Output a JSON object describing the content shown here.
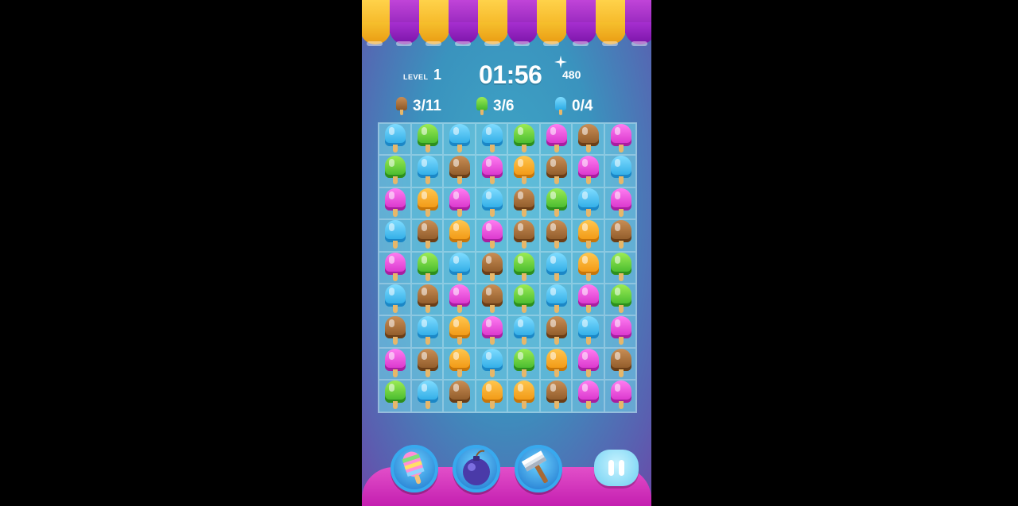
{
  "hud": {
    "level_label": "LEVEL",
    "level": "1",
    "timer": "01:56",
    "score": "480"
  },
  "goals": [
    {
      "color": "brown",
      "progress": "3/11"
    },
    {
      "color": "green",
      "progress": "3/6"
    },
    {
      "color": "blue",
      "progress": "0/4"
    }
  ],
  "board": {
    "columns": 8,
    "rows": 9,
    "cells": [
      [
        "blue",
        "green",
        "blue",
        "blue",
        "green",
        "pink",
        "brown",
        "pink"
      ],
      [
        "green",
        "blue",
        "brown",
        "pink",
        "orange",
        "brown",
        "pink",
        "blue"
      ],
      [
        "pink",
        "orange",
        "pink",
        "blue",
        "brown",
        "green",
        "blue",
        "pink"
      ],
      [
        "blue",
        "brown",
        "orange",
        "pink",
        "brown",
        "brown",
        "orange",
        "brown"
      ],
      [
        "pink",
        "green",
        "blue",
        "brown",
        "green",
        "blue",
        "orange",
        "green"
      ],
      [
        "blue",
        "brown",
        "pink",
        "brown",
        "green",
        "blue",
        "pink",
        "green"
      ],
      [
        "brown",
        "blue",
        "orange",
        "pink",
        "blue",
        "brown",
        "blue",
        "pink"
      ],
      [
        "pink",
        "brown",
        "orange",
        "blue",
        "green",
        "orange",
        "pink",
        "brown"
      ],
      [
        "green",
        "blue",
        "brown",
        "orange",
        "orange",
        "brown",
        "pink",
        "pink"
      ]
    ]
  },
  "boosters": [
    {
      "name": "striped-popsicle"
    },
    {
      "name": "bomb"
    },
    {
      "name": "hammer"
    }
  ],
  "colors": {
    "blue": "#28a8e4",
    "green": "#3fb52b",
    "pink": "#d62fc9",
    "orange": "#f0940f",
    "brown": "#8a5626",
    "awning_yellow": "#f6c02d",
    "awning_purple": "#8b1fb6"
  }
}
